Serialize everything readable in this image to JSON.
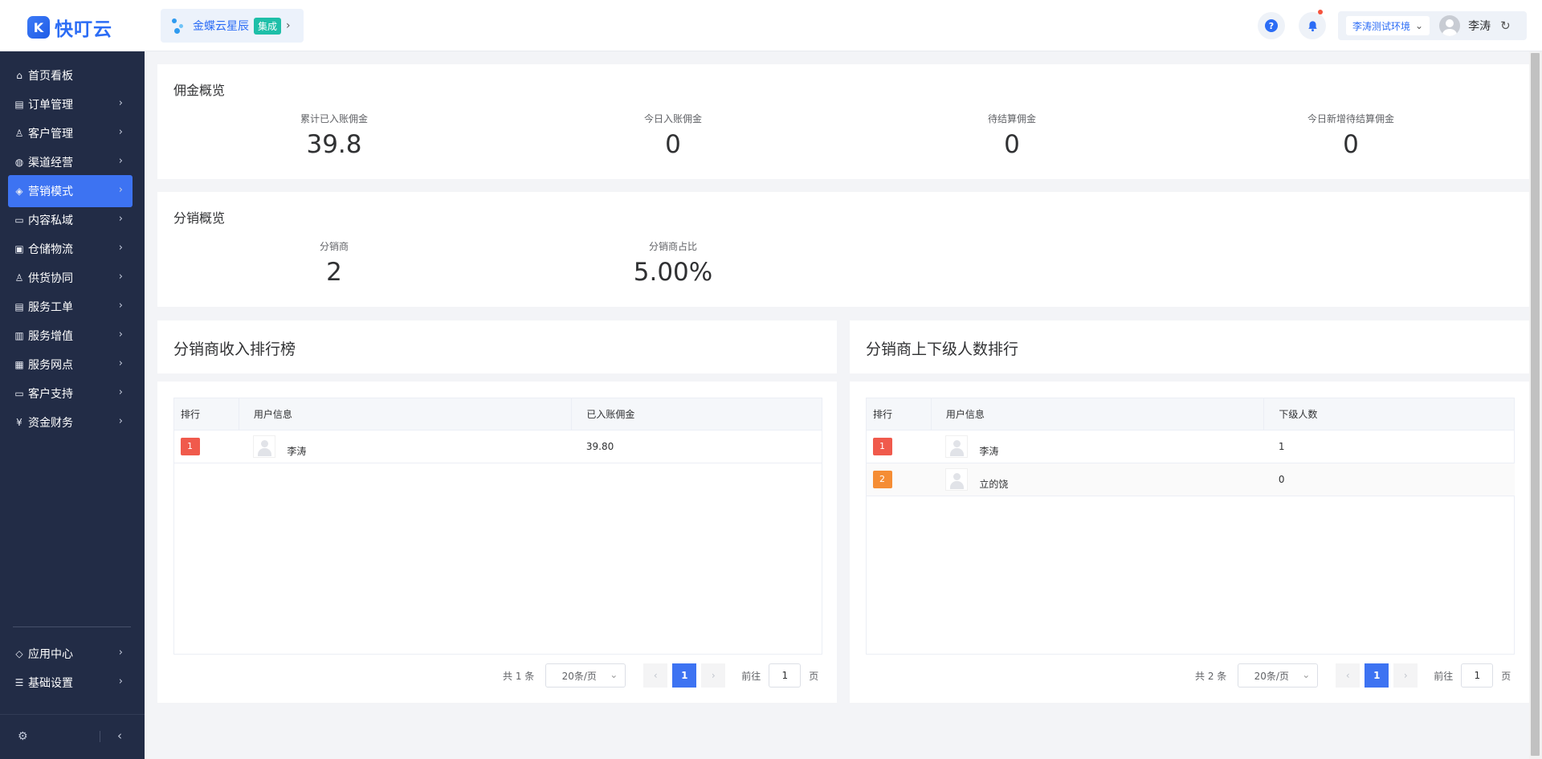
{
  "header": {
    "logo_text": "快叮云",
    "brand": {
      "name": "金蝶云星辰",
      "tag": "集成"
    },
    "env": "李涛测试环境",
    "user": "李涛"
  },
  "sidebar": {
    "items": [
      {
        "label": "首页看板",
        "icon": "⌂",
        "icon_name": "home-icon"
      },
      {
        "label": "订单管理",
        "icon": "▤",
        "icon_name": "order-icon"
      },
      {
        "label": "客户管理",
        "icon": "♙",
        "icon_name": "customer-icon"
      },
      {
        "label": "渠道经营",
        "icon": "◍",
        "icon_name": "channel-icon"
      },
      {
        "label": "营销模式",
        "icon": "◈",
        "icon_name": "marketing-icon"
      },
      {
        "label": "内容私域",
        "icon": "▭",
        "icon_name": "content-icon"
      },
      {
        "label": "仓储物流",
        "icon": "▣",
        "icon_name": "warehouse-icon"
      },
      {
        "label": "供货协同",
        "icon": "♙",
        "icon_name": "supply-icon"
      },
      {
        "label": "服务工单",
        "icon": "▤",
        "icon_name": "ticket-icon"
      },
      {
        "label": "服务增值",
        "icon": "▥",
        "icon_name": "value-added-icon"
      },
      {
        "label": "服务网点",
        "icon": "▦",
        "icon_name": "service-point-icon"
      },
      {
        "label": "客户支持",
        "icon": "▭",
        "icon_name": "support-icon"
      },
      {
        "label": "资金财务",
        "icon": "¥",
        "icon_name": "finance-icon"
      }
    ],
    "bottom_items": [
      {
        "label": "应用中心",
        "icon": "◇",
        "icon_name": "app-center-icon"
      },
      {
        "label": "基础设置",
        "icon": "☰",
        "icon_name": "settings-icon"
      }
    ],
    "active_index": 4
  },
  "commission": {
    "title": "佣金概览",
    "stats": [
      {
        "label": "累计已入账佣金",
        "value": "39.8"
      },
      {
        "label": "今日入账佣金",
        "value": "0"
      },
      {
        "label": "待结算佣金",
        "value": "0"
      },
      {
        "label": "今日新增待结算佣金",
        "value": "0"
      }
    ]
  },
  "distribution": {
    "title": "分销概览",
    "stats": [
      {
        "label": "分销商",
        "value": "2"
      },
      {
        "label": "分销商占比",
        "value": "5.00%"
      }
    ]
  },
  "income_rank": {
    "title": "分销商收入排行榜",
    "columns": [
      "排行",
      "用户信息",
      "已入账佣金"
    ],
    "rows": [
      {
        "rank": "1",
        "user": "李涛",
        "value": "39.80"
      }
    ],
    "pager": {
      "total": "共 1 条",
      "page_size": "20条/页",
      "current": "1",
      "goto_label": "前往",
      "goto_value": "1",
      "page_unit": "页"
    }
  },
  "member_rank": {
    "title": "分销商上下级人数排行",
    "columns": [
      "排行",
      "用户信息",
      "下级人数"
    ],
    "rows": [
      {
        "rank": "1",
        "user": "李涛",
        "value": "1"
      },
      {
        "rank": "2",
        "user": "立的饶",
        "value": "0"
      }
    ],
    "pager": {
      "total": "共 2 条",
      "page_size": "20条/页",
      "current": "1",
      "goto_label": "前往",
      "goto_value": "1",
      "page_unit": "页"
    }
  },
  "colors": {
    "accent": "#3d73f2",
    "sidebar": "#222c46",
    "rank1": "#f05a4c",
    "rank2": "#f58d34"
  }
}
